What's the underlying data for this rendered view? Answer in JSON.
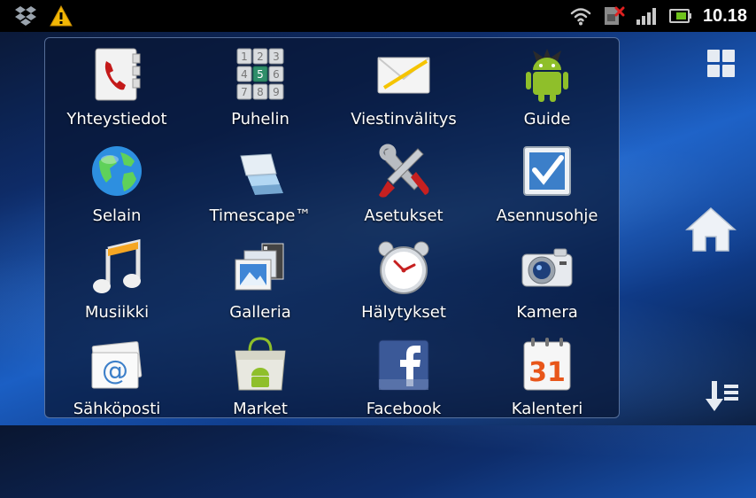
{
  "status_bar": {
    "time": "10.18",
    "icons": [
      "dropbox-icon",
      "warning-icon",
      "wifi-icon",
      "no-sim-icon",
      "signal-icon",
      "battery-icon"
    ]
  },
  "apps": [
    {
      "label": "Yhteystiedot",
      "icon": "contacts-icon"
    },
    {
      "label": "Puhelin",
      "icon": "phone-dialpad-icon"
    },
    {
      "label": "Viestinvälitys",
      "icon": "envelope-icon"
    },
    {
      "label": "Guide",
      "icon": "android-guide-icon"
    },
    {
      "label": "Selain",
      "icon": "globe-icon"
    },
    {
      "label": "Timescape™",
      "icon": "timescape-icon"
    },
    {
      "label": "Asetukset",
      "icon": "tools-icon"
    },
    {
      "label": "Asennusohje",
      "icon": "checkbox-icon"
    },
    {
      "label": "Musiikki",
      "icon": "music-note-icon"
    },
    {
      "label": "Galleria",
      "icon": "gallery-icon"
    },
    {
      "label": "Hälytykset",
      "icon": "alarm-clock-icon"
    },
    {
      "label": "Kamera",
      "icon": "camera-icon"
    },
    {
      "label": "Sähköposti",
      "icon": "email-at-icon"
    },
    {
      "label": "Market",
      "icon": "market-bag-icon"
    },
    {
      "label": "Facebook",
      "icon": "facebook-icon"
    },
    {
      "label": "Kalenteri",
      "icon": "calendar-icon"
    }
  ],
  "calendar_day": "31",
  "side_buttons": [
    "grid-view-icon",
    "home-icon",
    "sort-icon"
  ],
  "colors": {
    "drawer_bg": "#081634",
    "status_bg": "#000000",
    "label": "#ffffff"
  }
}
